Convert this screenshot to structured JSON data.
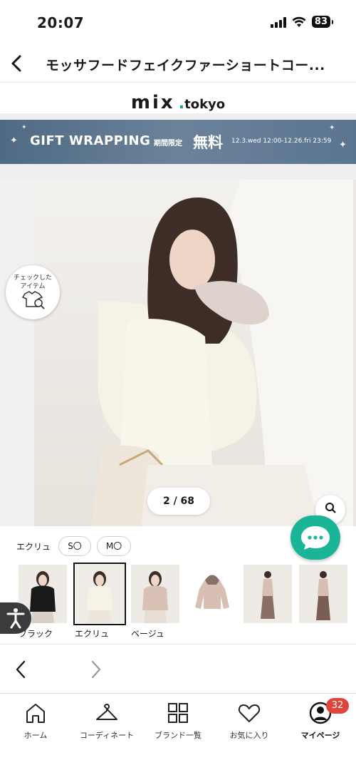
{
  "status_bar": {
    "time": "20:07",
    "battery": "83"
  },
  "header": {
    "title": "モッサフードフェイクファーショートコー..."
  },
  "logo": {
    "main": "mix",
    "dot": ".",
    "sub": "tokyo"
  },
  "banner": {
    "main": "GIFT WRAPPING",
    "limited": "期間限定",
    "free": "無料",
    "dates": "12.3.wed 12:00-12.26.fri 23:59"
  },
  "hero": {
    "checked_items_label": "チェックした\nアイテム",
    "page_indicator": "2 / 68"
  },
  "variant": {
    "color_label": "エクリュ",
    "sizes": [
      {
        "label": "S〇"
      },
      {
        "label": "M〇"
      }
    ]
  },
  "thumbnails": [
    {
      "label": "ブラック",
      "selected": false
    },
    {
      "label": "エクリュ",
      "selected": true
    },
    {
      "label": "ベージュ",
      "selected": false
    },
    {
      "label": "",
      "selected": false
    },
    {
      "label": "",
      "selected": false
    },
    {
      "label": "",
      "selected": false
    }
  ],
  "bottom_nav": {
    "items": [
      {
        "label": "ホーム",
        "icon": "home-icon"
      },
      {
        "label": "コーディネート",
        "icon": "hanger-icon"
      },
      {
        "label": "ブランド一覧",
        "icon": "grid-icon"
      },
      {
        "label": "お気に入り",
        "icon": "heart-icon"
      },
      {
        "label": "マイページ",
        "icon": "user-icon"
      }
    ],
    "mypage_badge": "32"
  },
  "colors": {
    "accent_green": "#1ab597",
    "banner_blue": "#5b7590",
    "badge_red": "#e0443e"
  }
}
